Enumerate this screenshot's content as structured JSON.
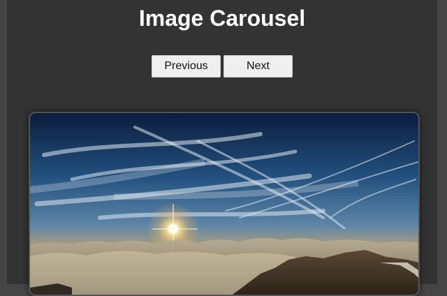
{
  "header": {
    "title": "Image Carousel"
  },
  "controls": {
    "previous_label": "Previous",
    "next_label": "Next"
  },
  "carousel": {
    "current_image_alt": "Sunrise over clouds from a mountain summit"
  },
  "colors": {
    "background": "#333333",
    "title": "#ffffff",
    "button_bg": "#efefef"
  }
}
